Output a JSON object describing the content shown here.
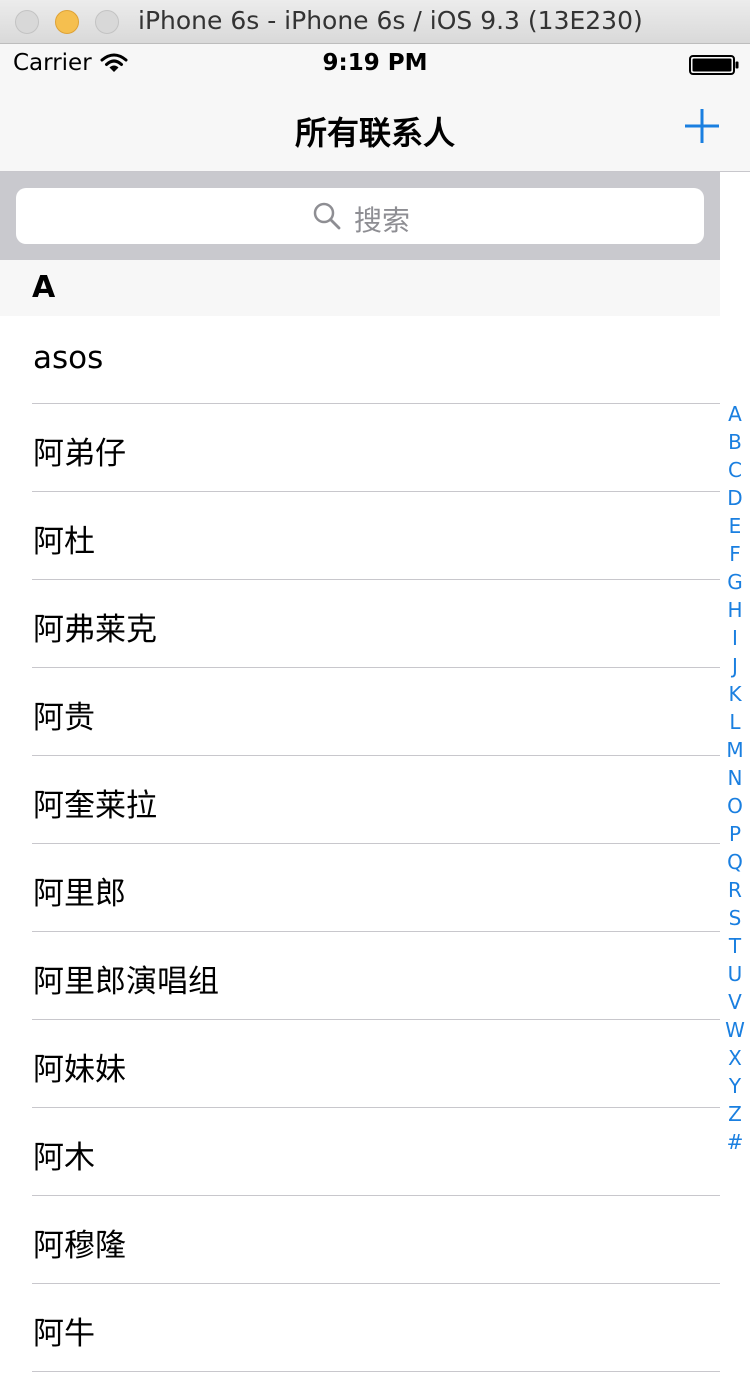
{
  "simulator": {
    "title": "iPhone 6s - iPhone 6s / iOS 9.3 (13E230)"
  },
  "status_bar": {
    "carrier": "Carrier",
    "time": "9:19 PM",
    "wifi_icon": "wifi-icon",
    "battery_icon": "battery-icon"
  },
  "nav_bar": {
    "title": "所有联系人",
    "add_icon": "plus-icon"
  },
  "search": {
    "placeholder": "搜索",
    "icon": "search-icon"
  },
  "section": {
    "title": "A"
  },
  "contacts": [
    "asos",
    "阿弟仔",
    "阿杜",
    "阿弗莱克",
    "阿贵",
    "阿奎莱拉",
    "阿里郎",
    "阿里郎演唱组",
    "阿妹妹",
    "阿木",
    "阿穆隆",
    "阿牛"
  ],
  "index": [
    "A",
    "B",
    "C",
    "D",
    "E",
    "F",
    "G",
    "H",
    "I",
    "J",
    "K",
    "L",
    "M",
    "N",
    "O",
    "P",
    "Q",
    "R",
    "S",
    "T",
    "U",
    "V",
    "W",
    "X",
    "Y",
    "Z",
    "#"
  ],
  "colors": {
    "accent": "#1a7fe0",
    "separator": "#c8c7cc",
    "search_bar_bg": "#c9c9ce"
  }
}
